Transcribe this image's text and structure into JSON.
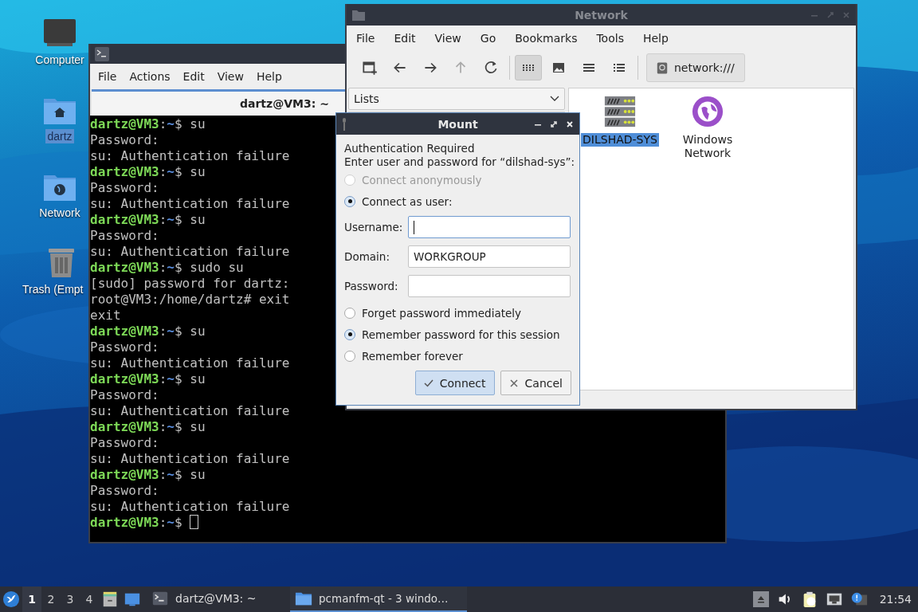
{
  "desktop": {
    "icons": [
      {
        "label": "Computer",
        "kind": "computer",
        "selected": false
      },
      {
        "label": "dartz",
        "kind": "home",
        "selected": true
      },
      {
        "label": "Network",
        "kind": "network",
        "selected": false
      },
      {
        "label": "Trash (Empt",
        "kind": "trash",
        "selected": false
      }
    ]
  },
  "terminal": {
    "menu": [
      "File",
      "Actions",
      "Edit",
      "View",
      "Help"
    ],
    "tab": "dartz@VM3: ~",
    "lines": [
      {
        "kind": "prompt",
        "user": "dartz@VM3",
        "colon": ":",
        "path": "~",
        "sign": "$",
        "command": "su"
      },
      {
        "kind": "output",
        "text": "Password:"
      },
      {
        "kind": "output",
        "text": "su: Authentication failure"
      },
      {
        "kind": "prompt",
        "user": "dartz@VM3",
        "colon": ":",
        "path": "~",
        "sign": "$",
        "command": "su"
      },
      {
        "kind": "output",
        "text": "Password:"
      },
      {
        "kind": "output",
        "text": "su: Authentication failure"
      },
      {
        "kind": "prompt",
        "user": "dartz@VM3",
        "colon": ":",
        "path": "~",
        "sign": "$",
        "command": "su"
      },
      {
        "kind": "output",
        "text": "Password:"
      },
      {
        "kind": "output",
        "text": "su: Authentication failure"
      },
      {
        "kind": "prompt",
        "user": "dartz@VM3",
        "colon": ":",
        "path": "~",
        "sign": "$",
        "command": "sudo su"
      },
      {
        "kind": "output",
        "text": "[sudo] password for dartz:"
      },
      {
        "kind": "output",
        "text": "root@VM3:/home/dartz# exit"
      },
      {
        "kind": "output",
        "text": "exit"
      },
      {
        "kind": "prompt",
        "user": "dartz@VM3",
        "colon": ":",
        "path": "~",
        "sign": "$",
        "command": "su"
      },
      {
        "kind": "output",
        "text": "Password:"
      },
      {
        "kind": "output",
        "text": "su: Authentication failure"
      },
      {
        "kind": "prompt",
        "user": "dartz@VM3",
        "colon": ":",
        "path": "~",
        "sign": "$",
        "command": "su"
      },
      {
        "kind": "output",
        "text": "Password:"
      },
      {
        "kind": "output",
        "text": "su: Authentication failure"
      },
      {
        "kind": "prompt",
        "user": "dartz@VM3",
        "colon": ":",
        "path": "~",
        "sign": "$",
        "command": "su"
      },
      {
        "kind": "output",
        "text": "Password:"
      },
      {
        "kind": "output",
        "text": "su: Authentication failure"
      },
      {
        "kind": "prompt",
        "user": "dartz@VM3",
        "colon": ":",
        "path": "~",
        "sign": "$",
        "command": "su"
      },
      {
        "kind": "output",
        "text": "Password:"
      },
      {
        "kind": "output",
        "text": "su: Authentication failure"
      },
      {
        "kind": "prompt",
        "user": "dartz@VM3",
        "colon": ":",
        "path": "~",
        "sign": "$",
        "cursor": true
      }
    ]
  },
  "file_manager": {
    "title": "Network",
    "menu": [
      "File",
      "Edit",
      "View",
      "Go",
      "Bookmarks",
      "Tools",
      "Help"
    ],
    "view_modes": [
      {
        "kind": "icons",
        "selected": true
      },
      {
        "kind": "thumbnails",
        "selected": false
      },
      {
        "kind": "compact",
        "selected": false
      },
      {
        "kind": "details",
        "selected": false
      }
    ],
    "address": "network:///",
    "side_pane": "Lists",
    "items": [
      {
        "label": "DILSHAD-SYS",
        "kind": "server",
        "selected": true
      },
      {
        "label": "Windows Network",
        "kind": "network",
        "selected": false
      }
    ]
  },
  "mount_dialog": {
    "title": "Mount",
    "heading": "Authentication Required",
    "message": "Enter user and password for “dilshad-sys”:",
    "connect_options": [
      {
        "label": "Connect anonymously",
        "selected": false,
        "disabled": true
      },
      {
        "label": "Connect as user:",
        "selected": true,
        "disabled": false
      }
    ],
    "fields": [
      {
        "label": "Username:",
        "focused": true
      },
      {
        "label": "Domain:",
        "value": "WORKGROUP",
        "focused": false
      },
      {
        "label": "Password:",
        "focused": false
      }
    ],
    "remember_options": [
      {
        "label": "Forget password immediately",
        "selected": false
      },
      {
        "label": "Remember password for this session",
        "selected": true
      },
      {
        "label": "Remember forever",
        "selected": false
      }
    ],
    "buttons": [
      {
        "label": "Connect",
        "kind": "connect",
        "default": true
      },
      {
        "label": "Cancel",
        "kind": "cancel",
        "default": false
      }
    ]
  },
  "taskbar": {
    "workspaces": [
      {
        "label": "1",
        "selected": true
      },
      {
        "label": "2",
        "selected": false
      },
      {
        "label": "3",
        "selected": false
      },
      {
        "label": "4",
        "selected": false
      }
    ],
    "tasks": [
      {
        "label": "dartz@VM3: ~",
        "kind": "terminal",
        "selected": false
      },
      {
        "label": "pcmanfm-qt - 3 windo…",
        "kind": "folder",
        "selected": true
      }
    ],
    "clock": "21:54"
  }
}
